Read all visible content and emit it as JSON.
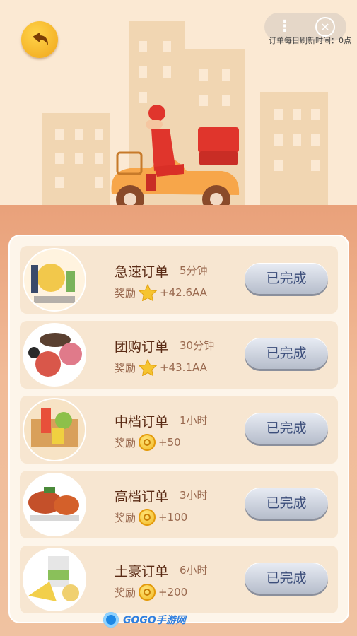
{
  "header": {
    "more_glyph": "⋮",
    "close_glyph": "✕",
    "refresh_text": "订单每日刷新时间：0点"
  },
  "orders": [
    {
      "title": "急速订单",
      "duration": "5分钟",
      "reward_label": "奖励",
      "reward_icon": "star-icon",
      "reward_amount": "+42.6AA",
      "button_label": "已完成"
    },
    {
      "title": "团购订单",
      "duration": "30分钟",
      "reward_label": "奖励",
      "reward_icon": "star-icon",
      "reward_amount": "+43.1AA",
      "button_label": "已完成"
    },
    {
      "title": "中档订单",
      "duration": "1小时",
      "reward_label": "奖励",
      "reward_icon": "coin-icon",
      "reward_amount": "+50",
      "button_label": "已完成"
    },
    {
      "title": "高档订单",
      "duration": "3小时",
      "reward_label": "奖励",
      "reward_icon": "coin-icon",
      "reward_amount": "+100",
      "button_label": "已完成"
    },
    {
      "title": "土豪订单",
      "duration": "6小时",
      "reward_label": "奖励",
      "reward_icon": "coin-icon",
      "reward_amount": "+200",
      "button_label": "已完成"
    }
  ],
  "watermark": "GOGO手游网",
  "colors": {
    "accent_orange": "#f0a51a",
    "title_brown": "#5a2a14",
    "button_text": "#3b4d7a"
  }
}
